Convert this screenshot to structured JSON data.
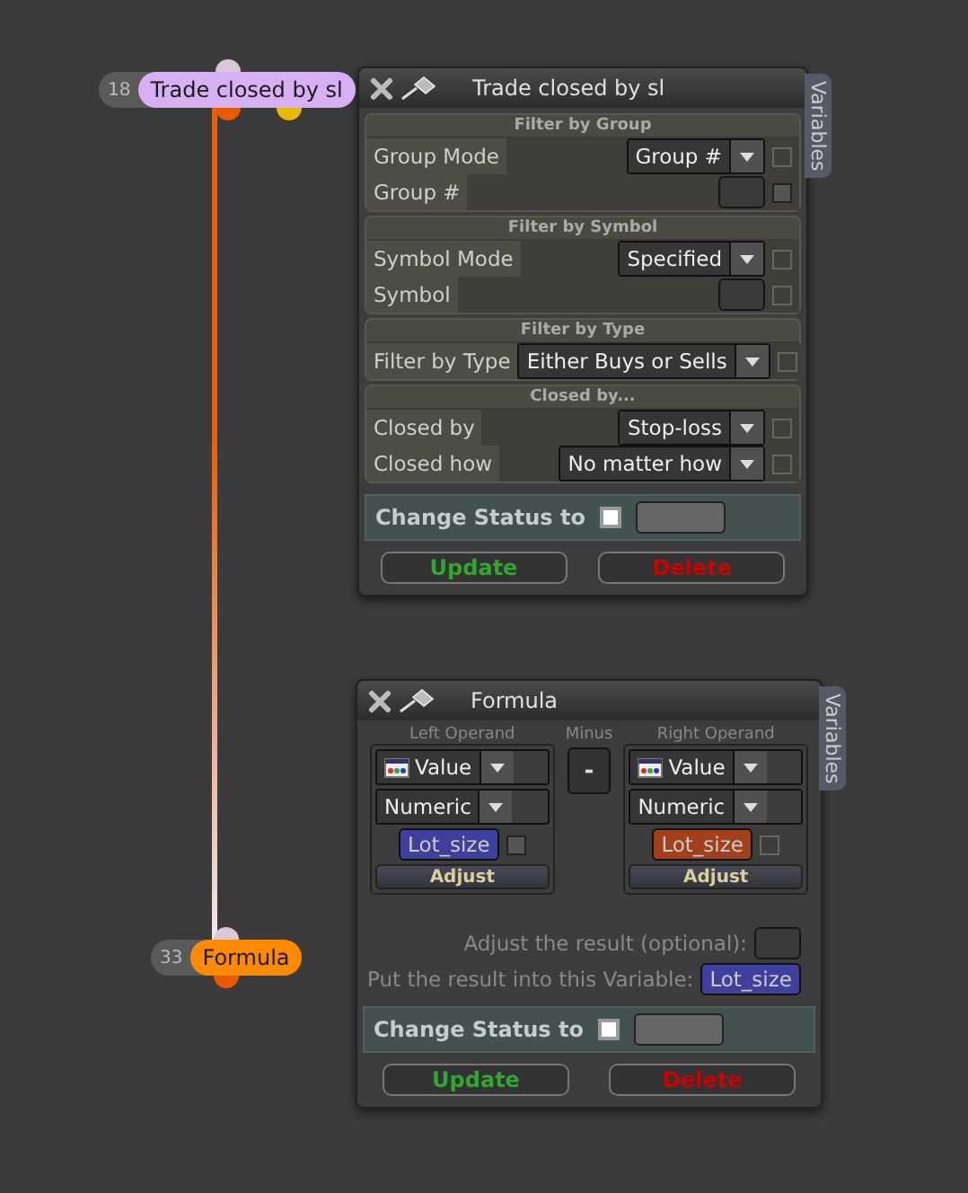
{
  "nodes": [
    {
      "number": "18",
      "label": "Trade closed by sl",
      "color": "#d6b0f2",
      "ports": [
        {
          "kind": "input"
        },
        {
          "kind": "output"
        },
        {
          "kind": "alternate"
        }
      ]
    },
    {
      "number": "33",
      "label": "Formula",
      "color": "#ff8a00",
      "ports": [
        {
          "kind": "input"
        },
        {
          "kind": "output"
        }
      ]
    }
  ],
  "panels": [
    {
      "kind": "filter",
      "title": "Trade closed by sl",
      "side_tab": "Variables",
      "sections": [
        {
          "heading": "Filter by Group",
          "rows": [
            {
              "label": "Group Mode",
              "kind": "dropdown",
              "value": "Group #",
              "checkbox_enabled": false
            },
            {
              "label": "Group #",
              "kind": "field",
              "checkbox_enabled": true
            }
          ]
        },
        {
          "heading": "Filter by Symbol",
          "rows": [
            {
              "label": "Symbol Mode",
              "kind": "dropdown",
              "value": "Specified",
              "checkbox_enabled": false
            },
            {
              "label": "Symbol",
              "kind": "field",
              "checkbox_enabled": false
            }
          ]
        },
        {
          "heading": "Filter by Type",
          "rows": [
            {
              "label": "Filter by Type",
              "kind": "dropdown",
              "value": "Either Buys or Sells",
              "checkbox_enabled": false
            }
          ]
        },
        {
          "heading": "Closed by...",
          "rows": [
            {
              "label": "Closed by",
              "kind": "dropdown",
              "value": "Stop-loss",
              "checkbox_enabled": false
            },
            {
              "label": "Closed how",
              "kind": "dropdown",
              "value": "No matter how",
              "checkbox_enabled": false
            }
          ]
        }
      ],
      "status": {
        "label": "Change Status to",
        "checked": false
      },
      "buttons": [
        {
          "label": "Update",
          "kind": "update"
        },
        {
          "label": "Delete",
          "kind": "delete"
        }
      ]
    },
    {
      "kind": "formula",
      "title": "Formula",
      "side_tab": "Variables",
      "operands": [
        {
          "heading": "Left Operand",
          "type": "Value",
          "format": "Numeric",
          "variable": "Lot_size",
          "color": "#3f3f9e",
          "checkbox_enabled": true,
          "adjust": "Adjust"
        },
        {
          "heading": "Right Operand",
          "type": "Value",
          "format": "Numeric",
          "variable": "Lot_size",
          "color": "#a3401c",
          "checkbox_enabled": false,
          "adjust": "Adjust"
        }
      ],
      "operator": {
        "heading": "Minus",
        "symbol": "-"
      },
      "adjust_label": "Adjust the result (optional):",
      "result_label": "Put the result into this Variable:",
      "result_variable": "Lot_size",
      "status": {
        "label": "Change Status to",
        "checked": false
      },
      "buttons": [
        {
          "label": "Update",
          "kind": "update"
        },
        {
          "label": "Delete",
          "kind": "delete"
        }
      ]
    }
  ]
}
